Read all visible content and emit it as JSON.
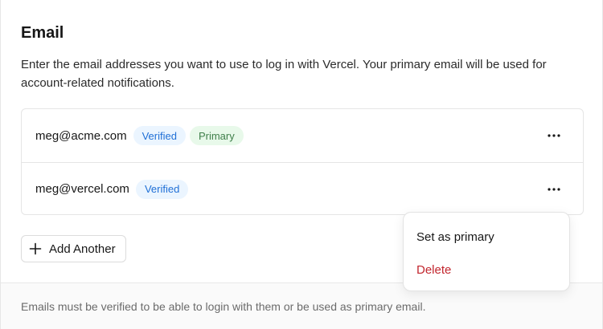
{
  "section": {
    "title": "Email",
    "description": "Enter the email addresses you want to use to log in with Vercel. Your primary email will be used for account-related notifications."
  },
  "emails": [
    {
      "address": "meg@acme.com",
      "badges": [
        "Verified",
        "Primary"
      ]
    },
    {
      "address": "meg@vercel.com",
      "badges": [
        "Verified"
      ]
    }
  ],
  "add_button": {
    "label": "Add Another",
    "icon": "plus-icon"
  },
  "dropdown_menu": {
    "items": [
      {
        "label": "Set as primary",
        "variant": "default"
      },
      {
        "label": "Delete",
        "variant": "danger"
      }
    ]
  },
  "footer": {
    "note": "Emails must be verified to be able to login with them or be used as primary email."
  },
  "colors": {
    "verified_bg": "#ebf5ff",
    "verified_text": "#1f6fd6",
    "primary_bg": "#e8f9ea",
    "primary_text": "#3f7f4a",
    "danger": "#c2262e"
  },
  "icons": {
    "row_menu": "more-horizontal-icon"
  }
}
